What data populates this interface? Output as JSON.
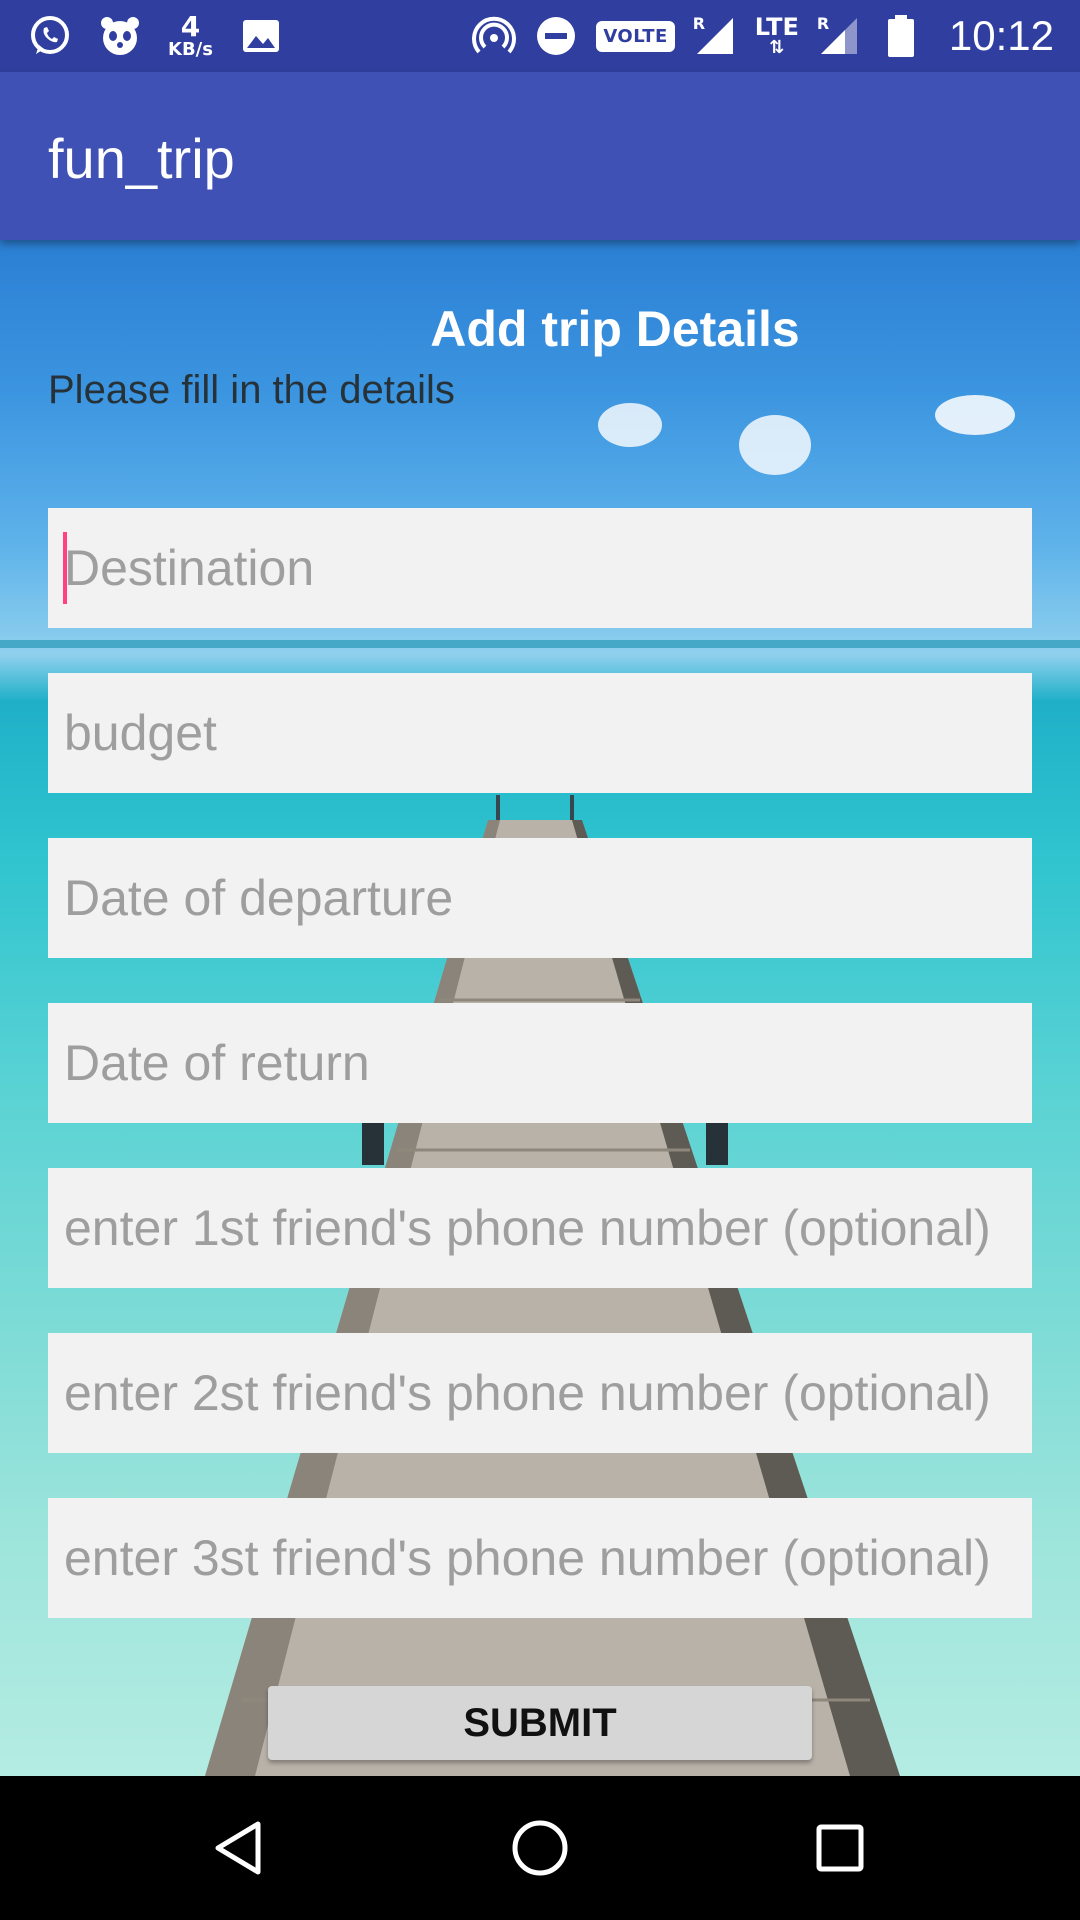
{
  "status_bar": {
    "speed_value": "4",
    "speed_unit": "KB/s",
    "volte_label": "VOLTE",
    "roaming_label": "R",
    "lte_label": "LTE",
    "time": "10:12"
  },
  "app_bar": {
    "title": "fun_trip"
  },
  "form": {
    "heading": "Add trip Details",
    "subheading": "Please fill in the details",
    "fields": [
      {
        "placeholder": "Destination",
        "focused": true
      },
      {
        "placeholder": "budget"
      },
      {
        "placeholder": "Date of departure"
      },
      {
        "placeholder": "Date of return"
      },
      {
        "placeholder": "enter 1st friend's phone number (optional)"
      },
      {
        "placeholder": "enter 2st friend's phone number (optional)"
      },
      {
        "placeholder": "enter 3st friend's phone number (optional)"
      }
    ],
    "submit_label": "SUBMIT"
  },
  "colors": {
    "status_bar": "#303F9F",
    "app_bar": "#3F51B5",
    "cursor": "#FF4081"
  },
  "icons": [
    "whatsapp-icon",
    "panda-icon",
    "image-icon",
    "hotspot-icon",
    "do-not-disturb-icon",
    "signal-icon",
    "battery-icon",
    "back-icon",
    "home-icon",
    "recents-icon"
  ]
}
